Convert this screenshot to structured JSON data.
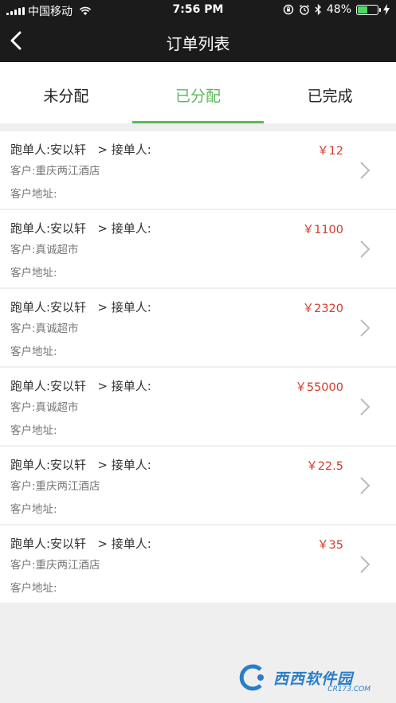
{
  "status_bar": {
    "carrier": "中国移动",
    "time": "7:56 PM",
    "battery": "48%",
    "battery_level": 0.48,
    "battery_color": "#4cd964"
  },
  "nav": {
    "title": "订单列表",
    "back_icon": "chevron-left-icon"
  },
  "tabs": [
    {
      "label": "未分配",
      "active": false
    },
    {
      "label": "已分配",
      "active": true
    },
    {
      "label": "已完成",
      "active": false
    }
  ],
  "colors": {
    "accent": "#5cb85c",
    "price": "#d23b2b",
    "header_bg": "#1b1b1b"
  },
  "orders": [
    {
      "runner": "跑单人:安以轩   > 接单人:",
      "price": "￥12",
      "customer": "客户:重庆两江酒店",
      "address": "客户地址:"
    },
    {
      "runner": "跑单人:安以轩   > 接单人:",
      "price": "￥1100",
      "customer": "客户:真诚超市",
      "address": "客户地址:"
    },
    {
      "runner": "跑单人:安以轩   > 接单人:",
      "price": "￥2320",
      "customer": "客户:真诚超市",
      "address": "客户地址:"
    },
    {
      "runner": "跑单人:安以轩   > 接单人:",
      "price": "￥55000",
      "customer": "客户:真诚超市",
      "address": "客户地址:"
    },
    {
      "runner": "跑单人:安以轩   > 接单人:",
      "price": "￥22.5",
      "customer": "客户:重庆两江酒店",
      "address": "客户地址:"
    },
    {
      "runner": "跑单人:安以轩   > 接单人:",
      "price": "￥35",
      "customer": "客户:重庆两江酒店",
      "address": "客户地址:"
    }
  ],
  "watermark": {
    "text": "西西软件园",
    "sub": "CR173.COM"
  }
}
